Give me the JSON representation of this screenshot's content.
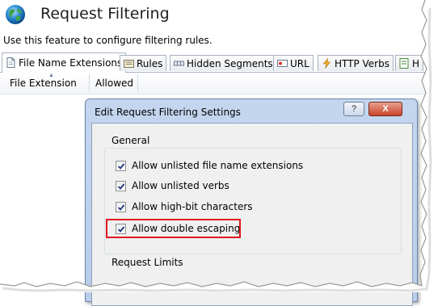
{
  "header": {
    "title": "Request Filtering",
    "description": "Use this feature to configure filtering rules."
  },
  "tabs": [
    {
      "label": "File Name Extensions",
      "icon": "document-icon",
      "active": true
    },
    {
      "label": "Rules",
      "icon": "rules-icon",
      "active": false
    },
    {
      "label": "Hidden Segments",
      "icon": "segments-icon",
      "active": false
    },
    {
      "label": "URL",
      "icon": "url-icon",
      "active": false
    },
    {
      "label": "HTTP Verbs",
      "icon": "lightning-icon",
      "active": false
    },
    {
      "label": "H",
      "icon": "headers-icon",
      "active": false
    }
  ],
  "columns": [
    "File Extension",
    "Allowed"
  ],
  "dialog": {
    "title": "Edit Request Filtering Settings",
    "help_label": "?",
    "close_label": "X",
    "general_label": "General",
    "options": [
      {
        "label": "Allow unlisted file name extensions",
        "checked": true
      },
      {
        "label": "Allow unlisted verbs",
        "checked": true
      },
      {
        "label": "Allow high-bit characters",
        "checked": true
      },
      {
        "label": "Allow double escaping",
        "checked": true
      }
    ],
    "limits_label": "Request Limits"
  },
  "colors": {
    "highlight": "#e0141e",
    "dialog_frame": "#b9cde8"
  }
}
